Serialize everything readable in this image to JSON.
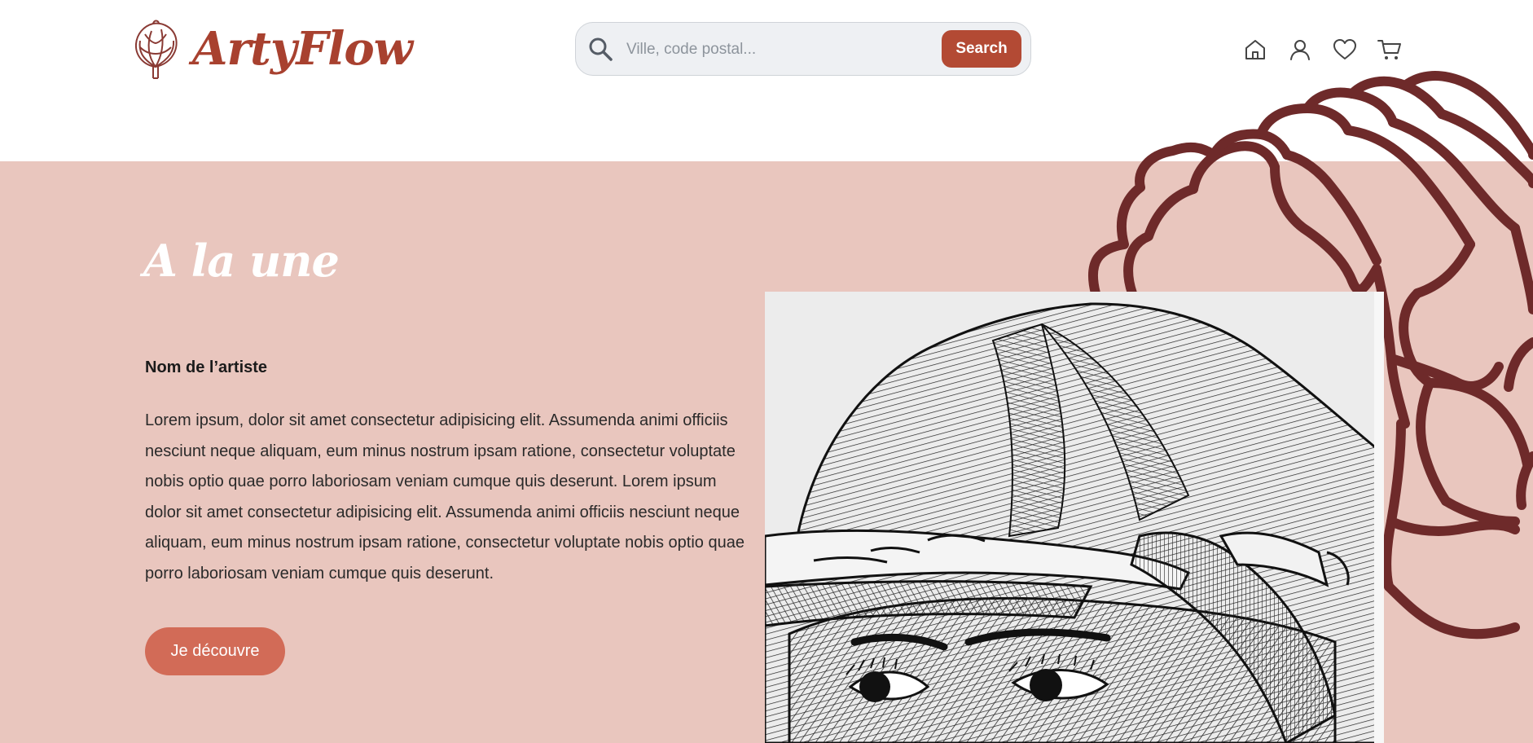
{
  "brand": {
    "name": "ArtyFlow",
    "logo_icon": "artichoke-icon",
    "color": "#a8412f"
  },
  "search": {
    "placeholder": "Ville, code postal...",
    "value": "",
    "button_label": "Search",
    "icon": "search-icon"
  },
  "nav": {
    "icons": [
      "home-icon",
      "user-icon",
      "heart-icon",
      "cart-icon"
    ]
  },
  "hero": {
    "title": "A la une",
    "artist_name": "Nom de l’artiste",
    "description": "Lorem ipsum, dolor sit amet consectetur adipisicing elit. Assumenda animi officiis nesciunt neque aliquam, eum minus nostrum ipsam ratione, consectetur voluptate nobis optio quae porro laboriosam veniam cumque quis deserunt. Lorem ipsum dolor sit amet consectetur adipisicing elit. Assumenda animi officiis nesciunt neque aliquam, eum minus nostrum ipsam ratione, consectetur voluptate nobis optio quae porro laboriosam veniam cumque quis deserunt.",
    "cta_label": "Je découvre",
    "artwork": "line-drawing-artwork"
  },
  "colors": {
    "hero_background": "#e9c6be",
    "accent": "#b34a34",
    "cta": "#d26b57",
    "decoration": "#6e2a2a"
  }
}
